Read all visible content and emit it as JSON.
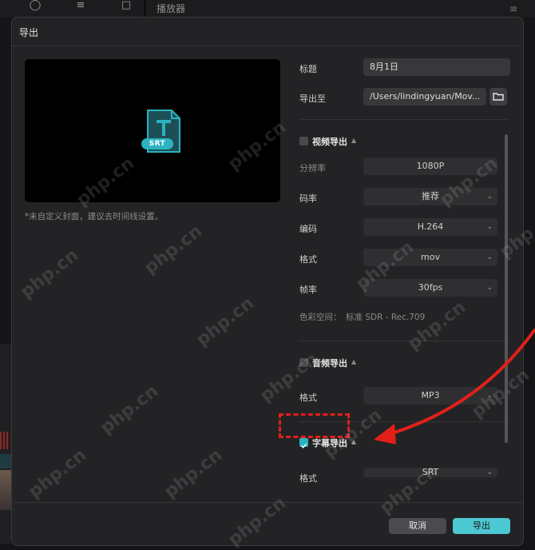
{
  "background": {
    "player_label": "播放器",
    "tool_icons": [
      "effects-icon",
      "adjust-icon",
      "export-icon"
    ]
  },
  "dialog": {
    "title": "导出",
    "preview": {
      "badge": "SRT",
      "icon": "text-file-icon"
    },
    "cover_note": "*未自定义封面，建议去时间线设置。",
    "fields": {
      "title_label": "标题",
      "title_value": "8月1日",
      "export_to_label": "导出至",
      "export_to_value": "/Users/lindingyuan/Mov...",
      "folder_icon": "folder-icon"
    },
    "video_export": {
      "heading": "视频导出",
      "checked": false,
      "resolution_label": "分辨率",
      "resolution_value": "1080P",
      "bitrate_label": "码率",
      "bitrate_value": "推荐",
      "codec_label": "编码",
      "codec_value": "H.264",
      "format_label": "格式",
      "format_value": "mov",
      "framerate_label": "帧率",
      "framerate_value": "30fps",
      "color_space_label": "色彩空间：",
      "color_space_value": "标准 SDR - Rec.709"
    },
    "audio_export": {
      "heading": "音频导出",
      "checked": false,
      "format_label": "格式",
      "format_value": "MP3"
    },
    "subtitle_export": {
      "heading": "字幕导出",
      "checked": true,
      "format_label": "格式",
      "format_value": "SRT"
    },
    "buttons": {
      "cancel": "取消",
      "export": "导出"
    }
  },
  "watermark_text": "php.cn",
  "colors": {
    "accent": "#4cc8d3",
    "annotation": "#e22018",
    "dialog_bg": "#232325"
  }
}
